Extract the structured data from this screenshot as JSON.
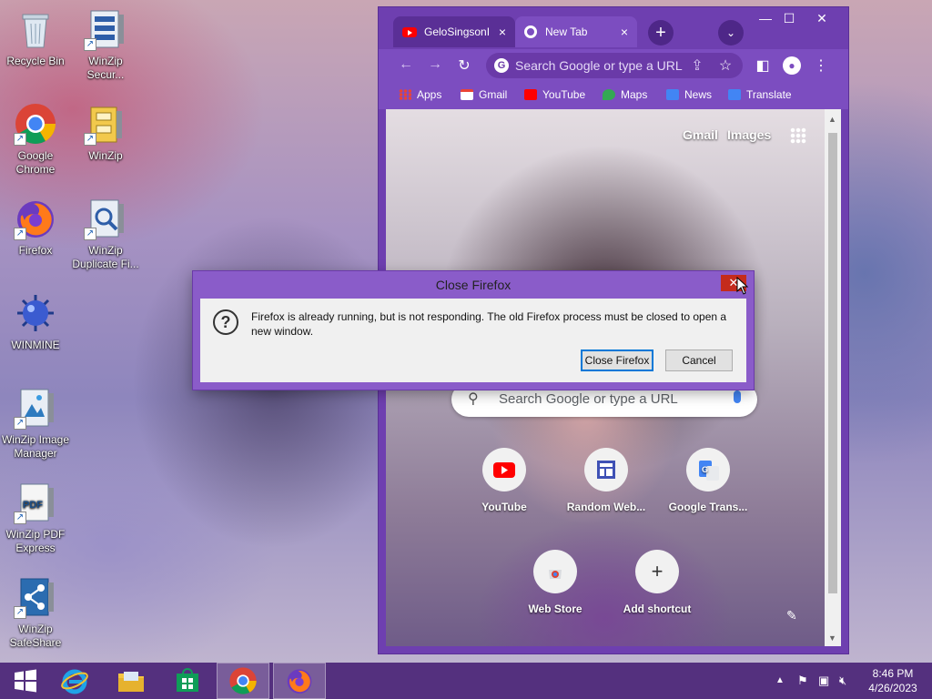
{
  "desktop": {
    "icons": [
      {
        "label": "Recycle Bin"
      },
      {
        "label": "WinZip Secur..."
      },
      {
        "label": "Google Chrome"
      },
      {
        "label": "WinZip"
      },
      {
        "label": "Firefox"
      },
      {
        "label": "WinZip Duplicate Fi..."
      },
      {
        "label": "WINMINE"
      },
      {
        "label": "WinZip Image Manager"
      },
      {
        "label": "WinZip PDF Express"
      },
      {
        "label": "WinZip SafeShare"
      }
    ]
  },
  "chrome": {
    "tabs": [
      {
        "label": "GeloSingsonI"
      },
      {
        "label": "New Tab"
      }
    ],
    "omnibox_placeholder": "Search Google or type a URL",
    "bookmarks": [
      {
        "label": "Apps"
      },
      {
        "label": "Gmail"
      },
      {
        "label": "YouTube"
      },
      {
        "label": "Maps"
      },
      {
        "label": "News"
      },
      {
        "label": "Translate"
      }
    ],
    "ntp": {
      "gmail": "Gmail",
      "images": "Images",
      "search_placeholder": "Search Google or type a URL",
      "shortcuts": [
        {
          "label": "YouTube"
        },
        {
          "label": "Random Web..."
        },
        {
          "label": "Google Trans..."
        },
        {
          "label": "Web Store"
        },
        {
          "label": "Add shortcut"
        }
      ]
    }
  },
  "dialog": {
    "title": "Close Firefox",
    "message": "Firefox is already running, but is not responding. The old Firefox process must be closed to open a new window.",
    "primary_button": "Close Firefox",
    "cancel_button": "Cancel"
  },
  "taskbar": {
    "time": "8:46 PM",
    "date": "4/26/2023"
  },
  "colors": {
    "chrome_theme": "#7c4dc0",
    "taskbar": "#54307e",
    "dialog_frame": "#8a5cc9",
    "close_red": "#c42b1c"
  }
}
